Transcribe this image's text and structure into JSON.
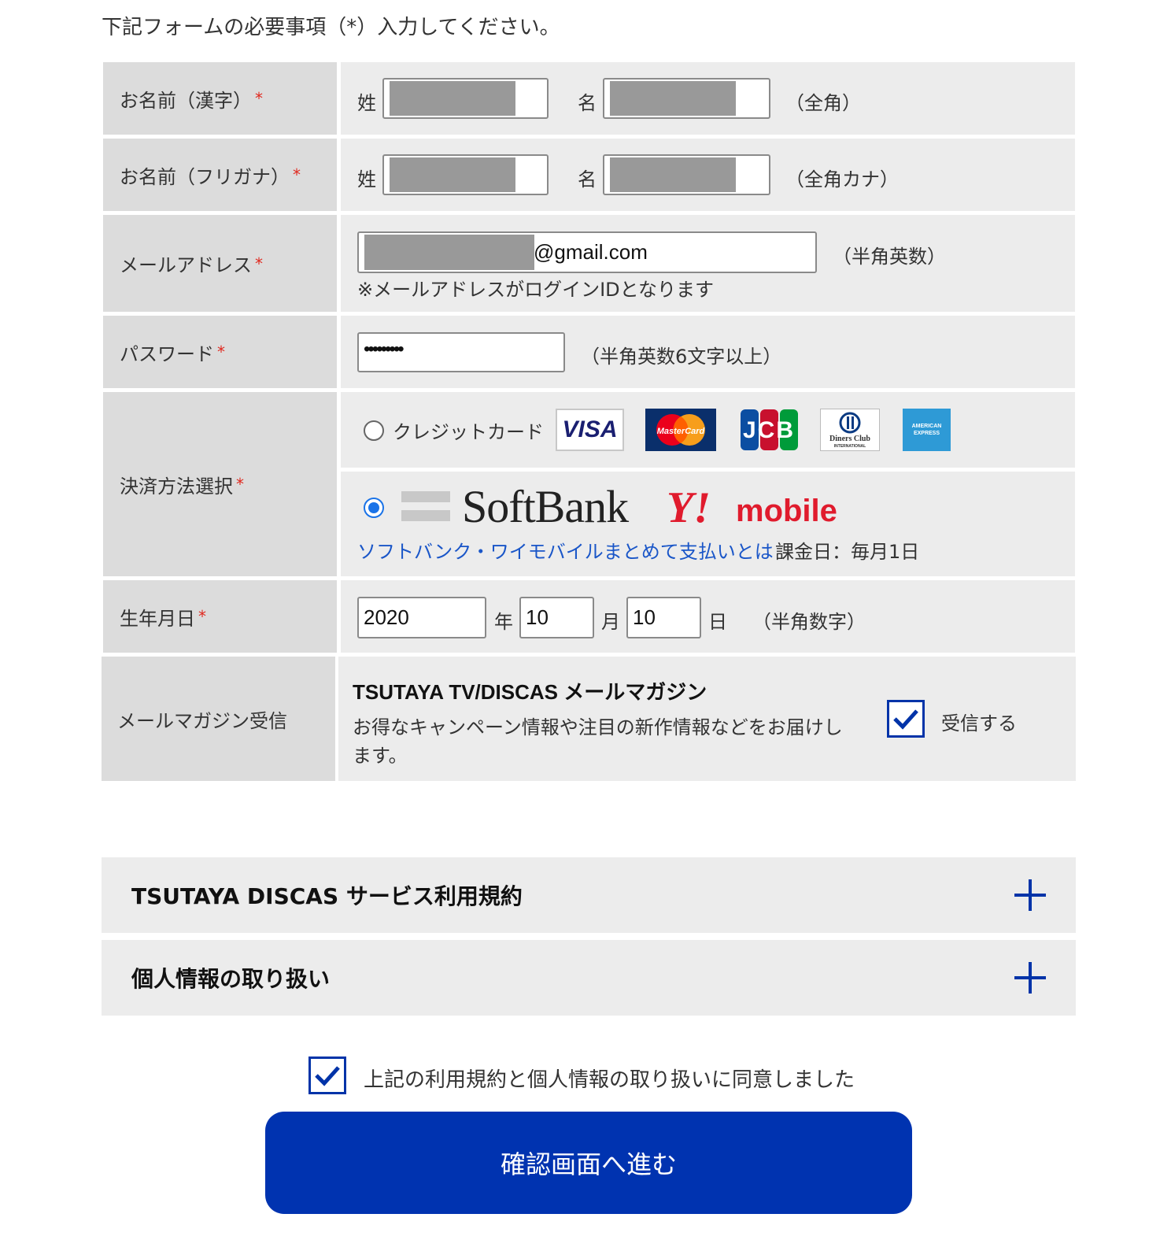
{
  "intro": "下記フォームの必要事項（*）入力してください。",
  "required_mark": "*",
  "name_kanji": {
    "label": "お名前（漢字）",
    "last_label": "姓",
    "first_label": "名",
    "note": "（全角）"
  },
  "name_kana": {
    "label": "お名前（フリガナ）",
    "last_label": "姓",
    "first_label": "名",
    "note": "（全角カナ）"
  },
  "email": {
    "label": "メールアドレス",
    "value_suffix": "@gmail.com",
    "note": "（半角英数）",
    "help": "※メールアドレスがログインIDとなります"
  },
  "password": {
    "label": "パスワード",
    "value": "•••••••••",
    "note": "（半角英数6文字以上）"
  },
  "payment": {
    "label": "決済方法選択",
    "credit_label": "クレジットカード",
    "credit_selected": false,
    "cards": [
      "VISA",
      "MasterCard",
      "JCB",
      "Diners Club",
      "AMERICAN EXPRESS"
    ],
    "carrier_selected": true,
    "softbank": "SoftBank",
    "ymobile_y": "Y!",
    "ymobile_text": "mobile",
    "carrier_link": "ソフトバンク・ワイモバイルまとめて支払いとは",
    "billing_day": "課金日：毎月1日"
  },
  "birthday": {
    "label": "生年月日",
    "year": "2020",
    "year_unit": "年",
    "month": "10",
    "month_unit": "月",
    "day": "10",
    "day_unit": "日",
    "note": "（半角数字）"
  },
  "newsletter": {
    "label": "メールマガジン受信",
    "title": "TSUTAYA TV/DISCAS メールマガジン",
    "desc_line1": "お得なキャンペーン情報や注目の新作情報などをお届けし",
    "desc_line2": "ます。",
    "checkbox_label": "受信する",
    "checked": true
  },
  "accordions": [
    {
      "title": "TSUTAYA DISCAS サービス利用規約"
    },
    {
      "title": "個人情報の取り扱い"
    }
  ],
  "agree": {
    "label": "上記の利用規約と個人情報の取り扱いに同意しました",
    "checked": true
  },
  "submit_label": "確認画面へ進む",
  "colors": {
    "accent": "#0033b0",
    "required": "#e0281e",
    "link": "#1a56c8",
    "label_bg": "#dcdcdc",
    "field_bg": "#ececec"
  }
}
